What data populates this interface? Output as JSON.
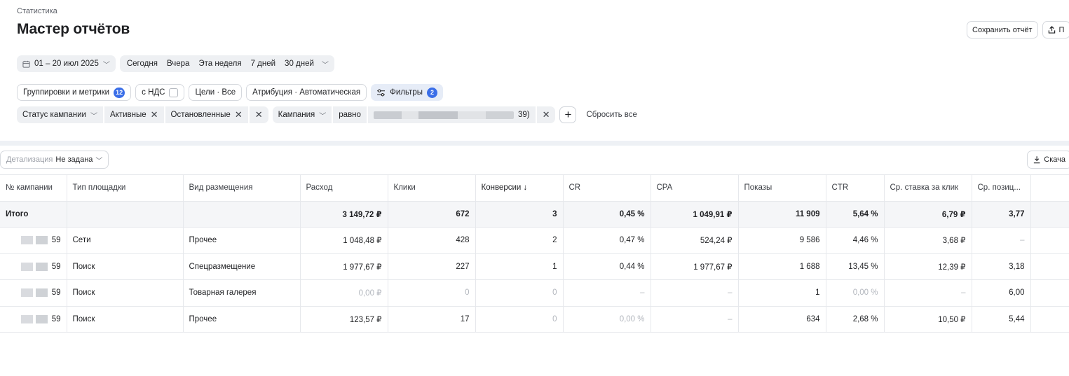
{
  "breadcrumb": "Статистика",
  "page_title": "Мастер отчётов",
  "actions": {
    "save_report": "Сохранить отчёт",
    "share_label": "П"
  },
  "date_range": "01 – 20 июл 2025",
  "quick_periods": [
    "Сегодня",
    "Вчера",
    "Эта неделя",
    "7 дней",
    "30 дней"
  ],
  "controls": {
    "groupings": "Группировки и метрики",
    "groupings_count": "12",
    "vat": "с НДС",
    "goals": "Цели · Все",
    "attribution": "Атрибуция · Автоматическая",
    "filters": "Фильтры",
    "filters_count": "2"
  },
  "filters": {
    "status_label": "Статус кампании",
    "status_values": [
      "Активные",
      "Остановленные"
    ],
    "campaign_label": "Кампания",
    "operator": "равно",
    "campaign_value_suffix": "39)",
    "reset": "Сбросить все"
  },
  "detail": {
    "label": "Детализация",
    "value": "Не задана"
  },
  "download_label": "Скача",
  "table": {
    "headers": [
      "№ кампании",
      "Тип площадки",
      "Вид размещения",
      "Расход",
      "Клики",
      "Конверсии ↓",
      "CR",
      "CPA",
      "Показы",
      "CTR",
      "Ср. ставка за клик",
      "Ср. позиц..."
    ],
    "total": [
      "Итого",
      "",
      "",
      "3 149,72 ₽",
      "672",
      "3",
      "0,45 %",
      "1 049,91 ₽",
      "11 909",
      "5,64 %",
      "6,79 ₽",
      "3,77"
    ],
    "rows": [
      [
        "59",
        "Сети",
        "Прочее",
        "1 048,48 ₽",
        "428",
        "2",
        "0,47 %",
        "524,24 ₽",
        "9 586",
        "4,46 %",
        "3,68 ₽",
        "–"
      ],
      [
        "59",
        "Поиск",
        "Спецразмещение",
        "1 977,67 ₽",
        "227",
        "1",
        "0,44 %",
        "1 977,67 ₽",
        "1 688",
        "13,45 %",
        "12,39 ₽",
        "3,18"
      ],
      [
        "59",
        "Поиск",
        "Товарная галерея",
        "0,00 ₽",
        "0",
        "0",
        "–",
        "–",
        "1",
        "0,00 %",
        "–",
        "6,00"
      ],
      [
        "59",
        "Поиск",
        "Прочее",
        "123,57 ₽",
        "17",
        "0",
        "0,00 %",
        "–",
        "634",
        "2,68 %",
        "10,50 ₽",
        "5,44"
      ]
    ]
  },
  "colors": {
    "accent": "#3a6ee8",
    "chip_bg": "#eef0f3",
    "total_bg": "#f5f6f8"
  }
}
